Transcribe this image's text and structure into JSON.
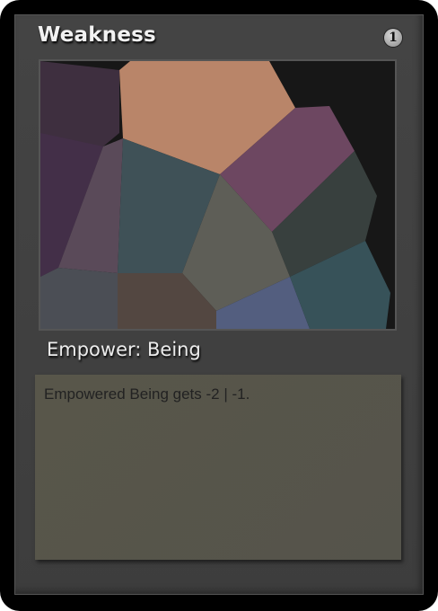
{
  "card": {
    "title": "Weakness",
    "cost": "1",
    "type_line": "Empower: Being",
    "rules_text": "Empowered Being gets -2 | -1."
  },
  "colors": {
    "card_border": "#000000",
    "card_frame": "#424242",
    "title_text": "#f2f2f2",
    "textbox_bg": "#57554a"
  },
  "art": {
    "style": "voronoi-mosaic"
  }
}
